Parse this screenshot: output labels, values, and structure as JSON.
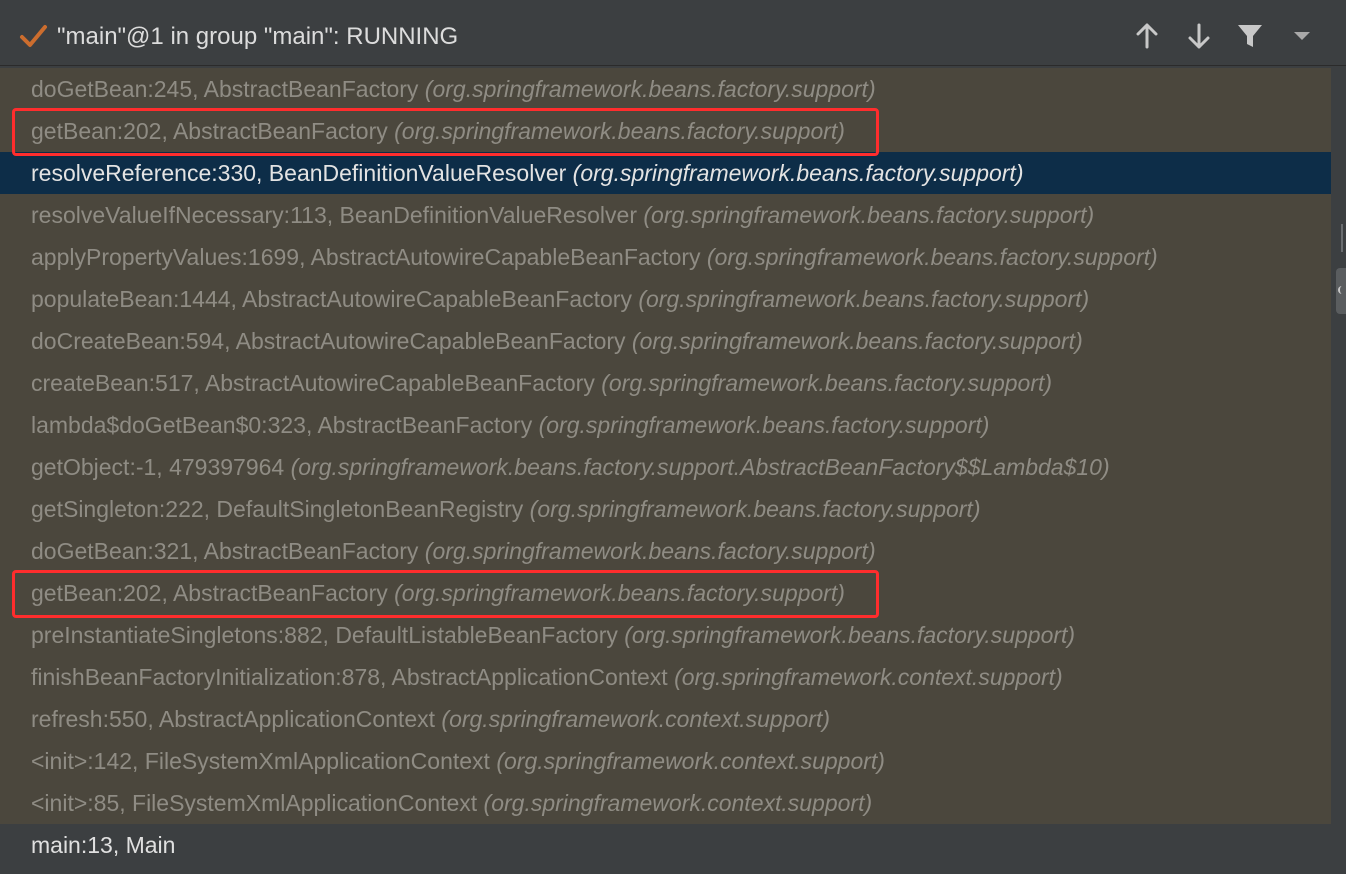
{
  "header": {
    "title": "\"main\"@1 in group \"main\": RUNNING",
    "status_icon": "check-icon",
    "tools": [
      "up-arrow-icon",
      "down-arrow-icon",
      "filter-icon",
      "dropdown-icon"
    ]
  },
  "frames": [
    {
      "method": "doGetBean:245, AbstractBeanFactory",
      "pkg": "(org.springframework.beans.factory.support)"
    },
    {
      "method": "getBean:202, AbstractBeanFactory",
      "pkg": "(org.springframework.beans.factory.support)"
    },
    {
      "method": "resolveReference:330, BeanDefinitionValueResolver",
      "pkg": "(org.springframework.beans.factory.support)"
    },
    {
      "method": "resolveValueIfNecessary:113, BeanDefinitionValueResolver",
      "pkg": "(org.springframework.beans.factory.support)"
    },
    {
      "method": "applyPropertyValues:1699, AbstractAutowireCapableBeanFactory",
      "pkg": "(org.springframework.beans.factory.support)"
    },
    {
      "method": "populateBean:1444, AbstractAutowireCapableBeanFactory",
      "pkg": "(org.springframework.beans.factory.support)"
    },
    {
      "method": "doCreateBean:594, AbstractAutowireCapableBeanFactory",
      "pkg": "(org.springframework.beans.factory.support)"
    },
    {
      "method": "createBean:517, AbstractAutowireCapableBeanFactory",
      "pkg": "(org.springframework.beans.factory.support)"
    },
    {
      "method": "lambda$doGetBean$0:323, AbstractBeanFactory",
      "pkg": "(org.springframework.beans.factory.support)"
    },
    {
      "method": "getObject:-1, 479397964",
      "pkg": "(org.springframework.beans.factory.support.AbstractBeanFactory$$Lambda$10)"
    },
    {
      "method": "getSingleton:222, DefaultSingletonBeanRegistry",
      "pkg": "(org.springframework.beans.factory.support)"
    },
    {
      "method": "doGetBean:321, AbstractBeanFactory",
      "pkg": "(org.springframework.beans.factory.support)"
    },
    {
      "method": "getBean:202, AbstractBeanFactory",
      "pkg": "(org.springframework.beans.factory.support)"
    },
    {
      "method": "preInstantiateSingletons:882, DefaultListableBeanFactory",
      "pkg": "(org.springframework.beans.factory.support)"
    },
    {
      "method": "finishBeanFactoryInitialization:878, AbstractApplicationContext",
      "pkg": "(org.springframework.context.support)"
    },
    {
      "method": "refresh:550, AbstractApplicationContext",
      "pkg": "(org.springframework.context.support)"
    },
    {
      "method": "<init>:142, FileSystemXmlApplicationContext",
      "pkg": "(org.springframework.context.support)"
    },
    {
      "method": "<init>:85, FileSystemXmlApplicationContext",
      "pkg": "(org.springframework.context.support)"
    }
  ],
  "selected_index": 2,
  "highlighted_indices": [
    1,
    12
  ],
  "footer": {
    "method": "main:13, Main"
  },
  "colors": {
    "accent_check": "#cc6d2e",
    "selection": "#0d2d48",
    "highlight_box": "#ff2d2d",
    "frames_bg": "#4b473d"
  }
}
